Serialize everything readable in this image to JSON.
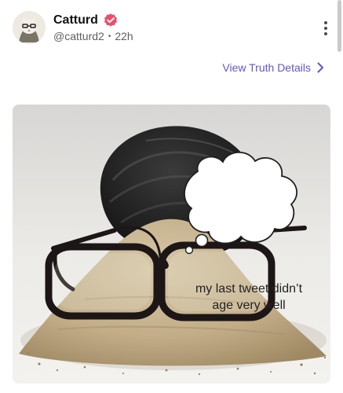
{
  "post": {
    "display_name": "Catturd",
    "handle": "@catturd2",
    "separator": "•",
    "time_ago": "22h",
    "verified_icon": "verified-badge-icon",
    "more_icon": "more-vertical-icon"
  },
  "details_link": {
    "label": "View Truth Details",
    "icon": "chevron-right-icon"
  },
  "media": {
    "caption_line1": "my last tweet didn’t",
    "caption_line2": "age very well"
  },
  "colors": {
    "accent": "#5e57c8",
    "verified": "#ea4f67",
    "muted_text": "#5d5d66"
  }
}
